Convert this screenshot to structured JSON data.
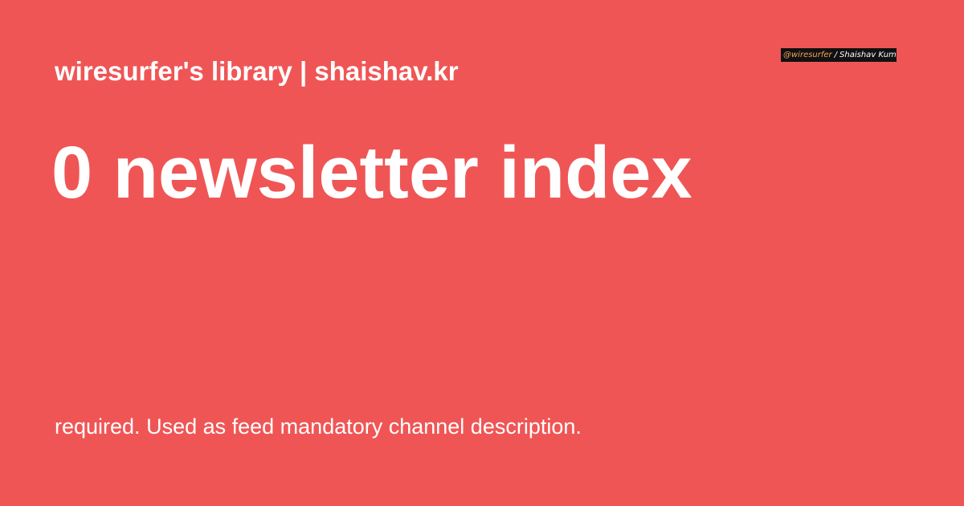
{
  "header": {
    "site_name": "wiresurfer's library | shaishav.kr"
  },
  "badge": {
    "handle": "@wiresurfer",
    "separator": "/",
    "author": "Shaishav Kumar"
  },
  "main": {
    "title": "0 newsletter index",
    "description": "required. Used as feed mandatory channel description."
  },
  "colors": {
    "background": "#f05555",
    "text": "#ffffff",
    "badge_background": "#111111",
    "badge_handle": "#f4a35c"
  }
}
